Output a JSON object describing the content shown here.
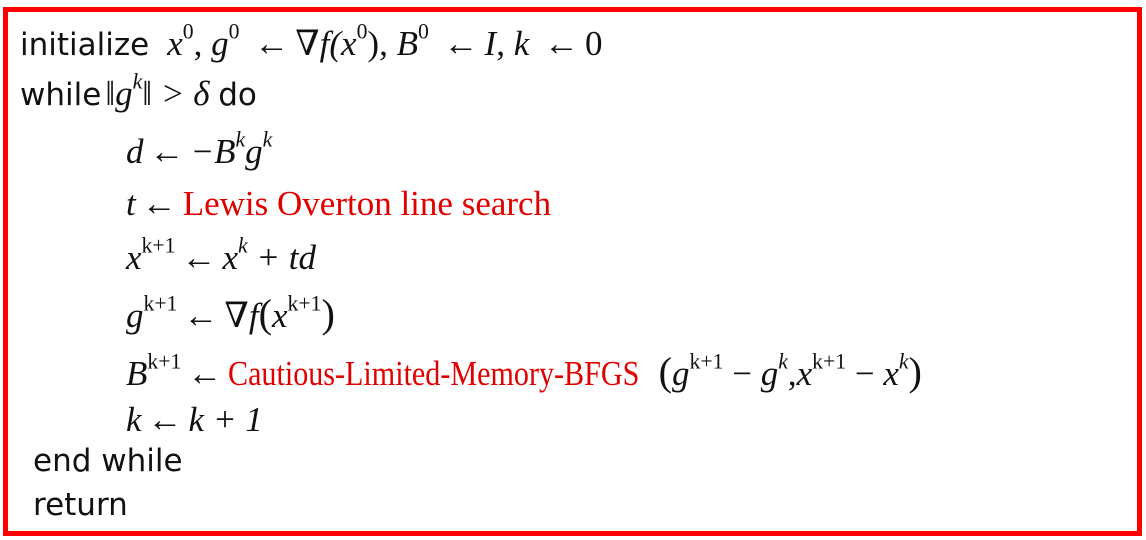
{
  "algorithm": {
    "border_color": "#ff0000",
    "highlight_color": "#e00000",
    "lines": {
      "initialize": {
        "keyword": "initialize",
        "x0": "x",
        "x0_sup": "0",
        "g0": "g",
        "g0_sup": "0",
        "arrow": "←",
        "grad": "∇f(x",
        "grad_sup": "0",
        "grad_close": ")",
        "B0": "B",
        "B0_sup": "0",
        "I": "I",
        "k": "k",
        "zero": "0"
      },
      "while": {
        "keyword": "while",
        "norm_open": "‖g",
        "norm_sup": "k",
        "norm_close": "‖",
        "gt_delta": "> δ",
        "do": "do"
      },
      "direction": {
        "lhs": "d",
        "arrow": "←",
        "rhs": "−B",
        "sup1": "k",
        "g": "g",
        "sup2": "k"
      },
      "step": {
        "lhs": "t",
        "arrow": "←",
        "method": "Lewis Overton line search"
      },
      "update_x": {
        "lhs": "x",
        "lhs_sup": "k+1",
        "arrow": "←",
        "x": "x",
        "x_sup": "k",
        "rest": "+ td"
      },
      "update_g": {
        "lhs": "g",
        "lhs_sup": "k+1",
        "arrow": "←",
        "grad": "∇f",
        "open": "(",
        "x": "x",
        "x_sup": "k+1",
        "close": ")"
      },
      "update_B": {
        "lhs": "B",
        "lhs_sup": "k+1",
        "arrow": "←",
        "method": "Cautious-Limited-Memory-BFGS",
        "open": "(",
        "g1": "g",
        "g1_sup": "k+1",
        "minus1": "−",
        "g2": "g",
        "g2_sup": "k",
        "comma": ",",
        "x1": "x",
        "x1_sup": "k+1",
        "minus2": "−",
        "x2": "x",
        "x2_sup": "k",
        "close": ")"
      },
      "increment": {
        "lhs": "k",
        "arrow": "←",
        "rhs": "k + 1"
      },
      "end_while": "end while",
      "return": "return"
    }
  }
}
